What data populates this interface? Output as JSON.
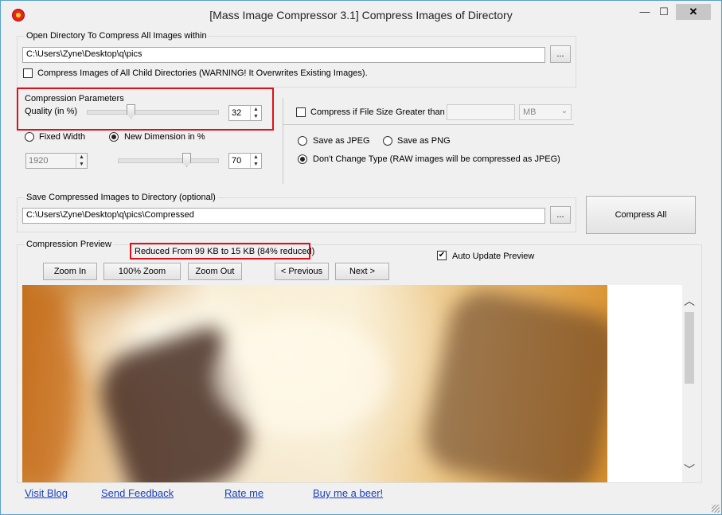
{
  "window": {
    "title": "[Mass Image Compressor 3.1] Compress Images of Directory",
    "controls": {
      "minimize": "—",
      "maximize": "☐",
      "close": "✕"
    }
  },
  "open_dir": {
    "group_label": "Open Directory To Compress All Images within",
    "path": "C:\\Users\\Zyne\\Desktop\\q\\pics",
    "browse_label": "...",
    "child_dirs_label": "Compress Images of All Child Directories (WARNING! It Overwrites Existing Images)."
  },
  "compression": {
    "group_label": "Compression Parameters",
    "quality_label": "Quality (in %)",
    "quality_value": "32",
    "quality_level": 0.32,
    "fixed_width_label": "Fixed Width",
    "fixed_width_value": "1920",
    "new_dimension_label": "New Dimension in %",
    "dimension_value": "70",
    "dimension_level": 0.7
  },
  "file_size": {
    "label": "Compress if File Size Greater than",
    "unit": "MB"
  },
  "save_type": {
    "jpeg_label": "Save as JPEG",
    "png_label": "Save as PNG",
    "dont_change_label": "Don't Change Type (RAW images will be compressed as JPEG)"
  },
  "save_dir": {
    "group_label": "Save Compressed Images to Directory (optional)",
    "path": "C:\\Users\\Zyne\\Desktop\\q\\pics\\Compressed",
    "browse_label": "..."
  },
  "compress_all_label": "Compress All",
  "preview": {
    "group_label": "Compression Preview",
    "reduced_text": "Reduced From 99 KB to 15 KB (84% reduced)",
    "auto_update_label": "Auto Update Preview",
    "zoom_in": "Zoom In",
    "zoom_100": "100% Zoom",
    "zoom_out": "Zoom Out",
    "previous": "< Previous",
    "next": "Next >"
  },
  "links": {
    "visit_blog": "Visit Blog",
    "send_feedback": "Send Feedback",
    "rate_me": "Rate me",
    "buy_beer": "Buy me a beer!"
  },
  "colors": {
    "highlight_red": "#e0101a",
    "link_blue": "#1a3fbf"
  }
}
